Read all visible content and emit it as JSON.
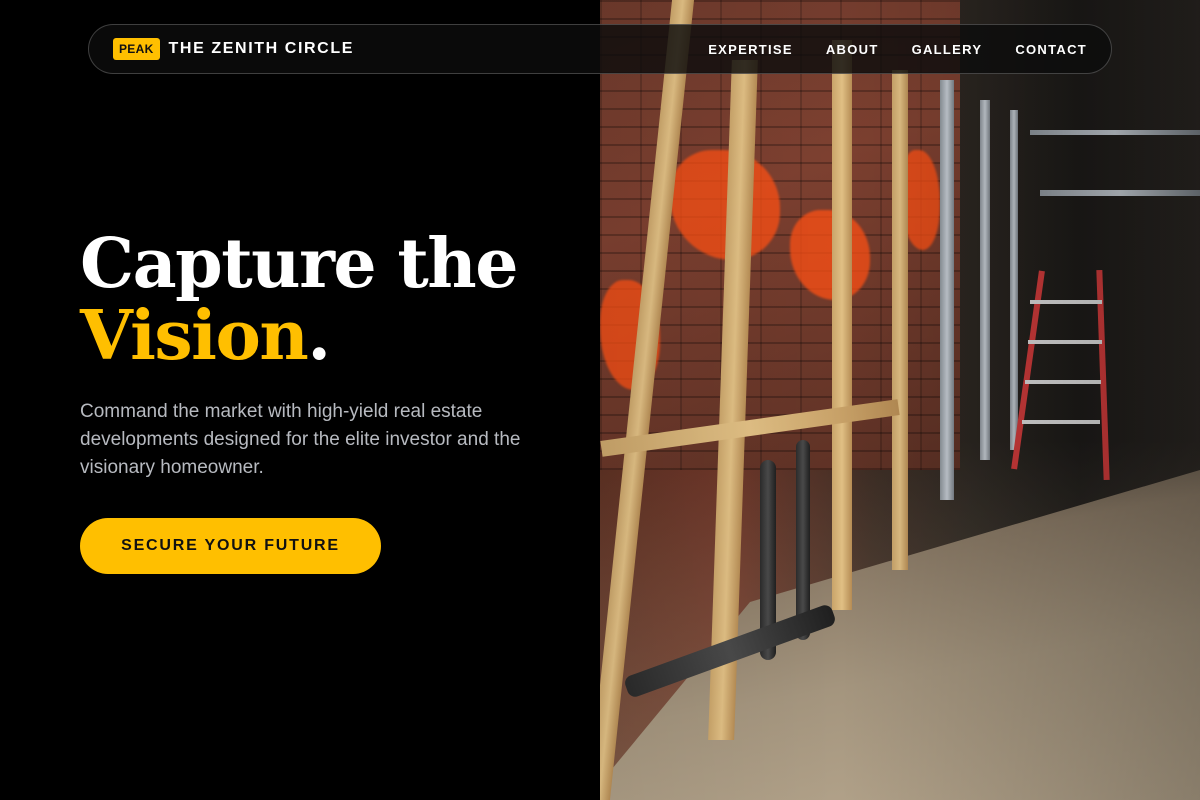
{
  "nav": {
    "badge": "PEAK",
    "brand": "THE ZENITH CIRCLE",
    "links": [
      "EXPERTISE",
      "ABOUT",
      "GALLERY",
      "CONTACT"
    ]
  },
  "hero": {
    "headline_line1": "Capture the",
    "headline_accent": "Vision",
    "headline_punct": ".",
    "subtext": "Command the market with high-yield real estate developments designed for the elite investor and the visionary homeowner.",
    "cta": "SECURE YOUR FUTURE"
  },
  "colors": {
    "accent": "#FFBF00",
    "background": "#000000",
    "subtext": "#B7BAC0"
  }
}
